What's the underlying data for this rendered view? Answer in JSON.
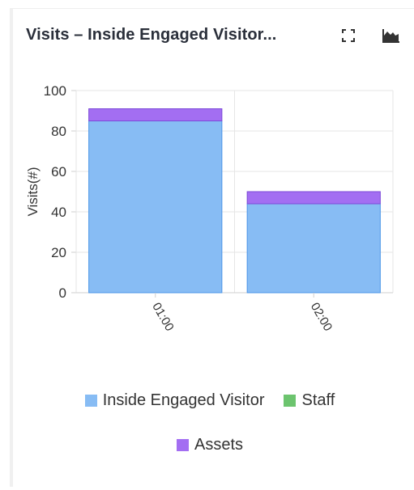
{
  "widget": {
    "title": "Visits – Inside Engaged Visitor...",
    "expand_icon": "expand-icon",
    "chart_type_icon": "area-chart-icon"
  },
  "chart_data": {
    "type": "bar",
    "stacked": true,
    "categories": [
      "01:00",
      "02:00"
    ],
    "series": [
      {
        "name": "Inside Engaged Visitor",
        "values": [
          85,
          44
        ],
        "color": "#87bcf4"
      },
      {
        "name": "Staff",
        "values": [
          0,
          0
        ],
        "color": "#6cc46e"
      },
      {
        "name": "Assets",
        "values": [
          6,
          6
        ],
        "color": "#a36ef2"
      }
    ],
    "ylabel": "Visits(#)",
    "xlabel": "",
    "ylim": [
      0,
      100
    ],
    "yticks": [
      0,
      20,
      40,
      60,
      80,
      100
    ],
    "grid": true,
    "legend_position": "bottom"
  }
}
